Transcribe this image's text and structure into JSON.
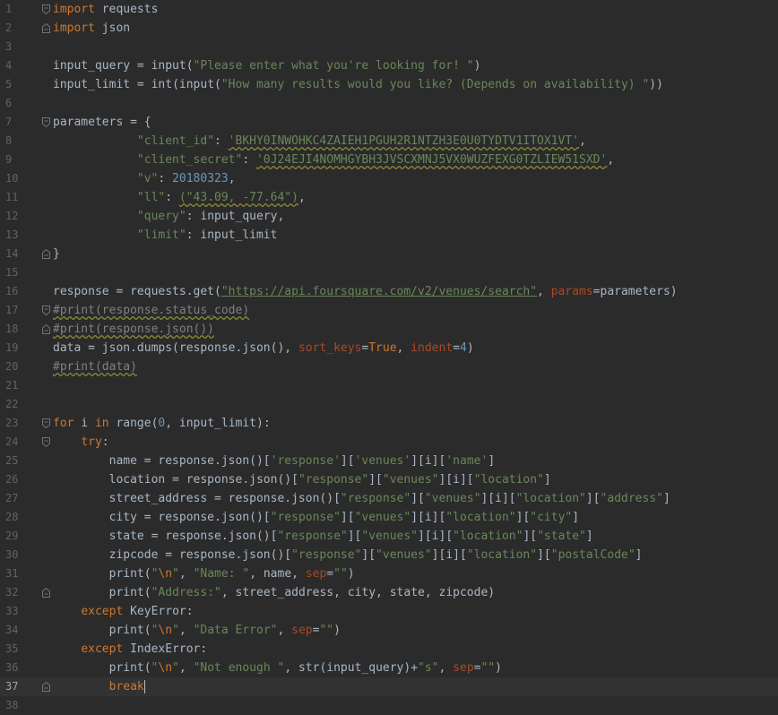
{
  "editor": {
    "current_line": 37,
    "lines": [
      {
        "n": "1",
        "fold": "start",
        "tokens": [
          [
            "kw",
            "import"
          ],
          [
            "p",
            " requests"
          ]
        ]
      },
      {
        "n": "2",
        "fold": "end",
        "tokens": [
          [
            "kw",
            "import"
          ],
          [
            "p",
            " json"
          ]
        ]
      },
      {
        "n": "3",
        "tokens": []
      },
      {
        "n": "4",
        "tokens": [
          [
            "p",
            "input_query = "
          ],
          [
            "fn",
            "input"
          ],
          [
            "p",
            "("
          ],
          [
            "str",
            "\"Please enter what you're looking for! \""
          ],
          [
            "p",
            ")"
          ]
        ]
      },
      {
        "n": "5",
        "tokens": [
          [
            "p",
            "input_limit = "
          ],
          [
            "fn",
            "int"
          ],
          [
            "p",
            "("
          ],
          [
            "fn",
            "input"
          ],
          [
            "p",
            "("
          ],
          [
            "str",
            "\"How many results would you like? (Depends on availability) \""
          ],
          [
            "p",
            "))"
          ]
        ]
      },
      {
        "n": "6",
        "tokens": []
      },
      {
        "n": "7",
        "fold": "start",
        "tokens": [
          [
            "p",
            "parameters = {"
          ]
        ]
      },
      {
        "n": "8",
        "tokens": [
          [
            "p",
            "            "
          ],
          [
            "str",
            "\"client_id\""
          ],
          [
            "p",
            ": "
          ],
          [
            "strw",
            "'BKHY0INWOHKC4ZAIEH1PGUH2R1NTZH3E0U0TYDTV1ITOX1VT'"
          ],
          [
            "p",
            ","
          ]
        ]
      },
      {
        "n": "9",
        "tokens": [
          [
            "p",
            "            "
          ],
          [
            "str",
            "\"client_secret\""
          ],
          [
            "p",
            ": "
          ],
          [
            "strw",
            "'0J24EJI4NOMHGYBH3JVSCXMNJ5VX0WUZFEXG0TZLIEW51SXD'"
          ],
          [
            "p",
            ","
          ]
        ]
      },
      {
        "n": "10",
        "tokens": [
          [
            "p",
            "            "
          ],
          [
            "str",
            "\"v\""
          ],
          [
            "p",
            ": "
          ],
          [
            "num",
            "20180323"
          ],
          [
            "p",
            ","
          ]
        ]
      },
      {
        "n": "11",
        "tokens": [
          [
            "p",
            "            "
          ],
          [
            "str",
            "\"ll\""
          ],
          [
            "p",
            ": "
          ],
          [
            "strw",
            "(\"43.09, -77.64\")"
          ],
          [
            "p",
            ","
          ]
        ]
      },
      {
        "n": "12",
        "tokens": [
          [
            "p",
            "            "
          ],
          [
            "str",
            "\"query\""
          ],
          [
            "p",
            ": input_query,"
          ]
        ]
      },
      {
        "n": "13",
        "tokens": [
          [
            "p",
            "            "
          ],
          [
            "str",
            "\"limit\""
          ],
          [
            "p",
            ": input_limit"
          ]
        ]
      },
      {
        "n": "14",
        "fold": "end",
        "tokens": [
          [
            "p",
            "}"
          ]
        ]
      },
      {
        "n": "15",
        "tokens": []
      },
      {
        "n": "16",
        "tokens": [
          [
            "p",
            "response = requests.get("
          ],
          [
            "url",
            "\"https://api.foursquare.com/v2/venues/search\""
          ],
          [
            "p",
            ", "
          ],
          [
            "kwarg",
            "params"
          ],
          [
            "p",
            "=parameters)"
          ]
        ]
      },
      {
        "n": "17",
        "fold": "start",
        "tokens": [
          [
            "cmt",
            "#print(response.status_code)"
          ]
        ]
      },
      {
        "n": "18",
        "fold": "end",
        "tokens": [
          [
            "cmt",
            "#print(response.json())"
          ]
        ]
      },
      {
        "n": "19",
        "tokens": [
          [
            "p",
            "data = json.dumps(response.json(), "
          ],
          [
            "kwarg",
            "sort_keys"
          ],
          [
            "p",
            "="
          ],
          [
            "kw",
            "True"
          ],
          [
            "p",
            ", "
          ],
          [
            "kwarg",
            "indent"
          ],
          [
            "p",
            "="
          ],
          [
            "num",
            "4"
          ],
          [
            "p",
            ")"
          ]
        ]
      },
      {
        "n": "20",
        "tokens": [
          [
            "cmt",
            "#print(data)"
          ]
        ]
      },
      {
        "n": "21",
        "tokens": []
      },
      {
        "n": "22",
        "tokens": []
      },
      {
        "n": "23",
        "fold": "start",
        "tokens": [
          [
            "kw",
            "for"
          ],
          [
            "p",
            " i "
          ],
          [
            "kw",
            "in"
          ],
          [
            "p",
            " "
          ],
          [
            "fn",
            "range"
          ],
          [
            "p",
            "("
          ],
          [
            "num",
            "0"
          ],
          [
            "p",
            ", input_limit):"
          ]
        ]
      },
      {
        "n": "24",
        "fold": "start",
        "tokens": [
          [
            "p",
            "    "
          ],
          [
            "kw",
            "try"
          ],
          [
            "p",
            ":"
          ]
        ]
      },
      {
        "n": "25",
        "tokens": [
          [
            "p",
            "        name = response.json()["
          ],
          [
            "str",
            "'response'"
          ],
          [
            "p",
            "]["
          ],
          [
            "str",
            "'venues'"
          ],
          [
            "p",
            "][i]["
          ],
          [
            "str",
            "'name'"
          ],
          [
            "p",
            "]"
          ]
        ]
      },
      {
        "n": "26",
        "tokens": [
          [
            "p",
            "        location = response.json()["
          ],
          [
            "str",
            "\"response\""
          ],
          [
            "p",
            "]["
          ],
          [
            "str",
            "\"venues\""
          ],
          [
            "p",
            "][i]["
          ],
          [
            "str",
            "\"location\""
          ],
          [
            "p",
            "]"
          ]
        ]
      },
      {
        "n": "27",
        "tokens": [
          [
            "p",
            "        street_address = response.json()["
          ],
          [
            "str",
            "\"response\""
          ],
          [
            "p",
            "]["
          ],
          [
            "str",
            "\"venues\""
          ],
          [
            "p",
            "][i]["
          ],
          [
            "str",
            "\"location\""
          ],
          [
            "p",
            "]["
          ],
          [
            "str",
            "\"address\""
          ],
          [
            "p",
            "]"
          ]
        ]
      },
      {
        "n": "28",
        "tokens": [
          [
            "p",
            "        city = response.json()["
          ],
          [
            "str",
            "\"response\""
          ],
          [
            "p",
            "]["
          ],
          [
            "str",
            "\"venues\""
          ],
          [
            "p",
            "][i]["
          ],
          [
            "str",
            "\"location\""
          ],
          [
            "p",
            "]["
          ],
          [
            "str",
            "\"city\""
          ],
          [
            "p",
            "]"
          ]
        ]
      },
      {
        "n": "29",
        "tokens": [
          [
            "p",
            "        state = response.json()["
          ],
          [
            "str",
            "\"response\""
          ],
          [
            "p",
            "]["
          ],
          [
            "str",
            "\"venues\""
          ],
          [
            "p",
            "][i]["
          ],
          [
            "str",
            "\"location\""
          ],
          [
            "p",
            "]["
          ],
          [
            "str",
            "\"state\""
          ],
          [
            "p",
            "]"
          ]
        ]
      },
      {
        "n": "30",
        "tokens": [
          [
            "p",
            "        zipcode = response.json()["
          ],
          [
            "str",
            "\"response\""
          ],
          [
            "p",
            "]["
          ],
          [
            "str",
            "\"venues\""
          ],
          [
            "p",
            "][i]["
          ],
          [
            "str",
            "\"location\""
          ],
          [
            "p",
            "]["
          ],
          [
            "str",
            "\"postalCode\""
          ],
          [
            "p",
            "]"
          ]
        ]
      },
      {
        "n": "31",
        "tokens": [
          [
            "p",
            "        "
          ],
          [
            "fn",
            "print"
          ],
          [
            "p",
            "("
          ],
          [
            "str",
            "\""
          ],
          [
            "esc",
            "\\n"
          ],
          [
            "str",
            "\""
          ],
          [
            "p",
            ", "
          ],
          [
            "str",
            "\"Name: \""
          ],
          [
            "p",
            ", name, "
          ],
          [
            "kwarg",
            "sep"
          ],
          [
            "p",
            "="
          ],
          [
            "str",
            "\"\""
          ],
          [
            "p",
            ")"
          ]
        ]
      },
      {
        "n": "32",
        "fold": "end",
        "tokens": [
          [
            "p",
            "        "
          ],
          [
            "fn",
            "print"
          ],
          [
            "p",
            "("
          ],
          [
            "str",
            "\"Address:\""
          ],
          [
            "p",
            ", street_address, city, state, zipcode)"
          ]
        ]
      },
      {
        "n": "33",
        "tokens": [
          [
            "p",
            "    "
          ],
          [
            "kw",
            "except"
          ],
          [
            "p",
            " "
          ],
          [
            "exc",
            "KeyError"
          ],
          [
            "p",
            ":"
          ]
        ]
      },
      {
        "n": "34",
        "tokens": [
          [
            "p",
            "        "
          ],
          [
            "fn",
            "print"
          ],
          [
            "p",
            "("
          ],
          [
            "str",
            "\""
          ],
          [
            "esc",
            "\\n"
          ],
          [
            "str",
            "\""
          ],
          [
            "p",
            ", "
          ],
          [
            "str",
            "\"Data Error\""
          ],
          [
            "p",
            ", "
          ],
          [
            "kwarg",
            "sep"
          ],
          [
            "p",
            "="
          ],
          [
            "str",
            "\"\""
          ],
          [
            "p",
            ")"
          ]
        ]
      },
      {
        "n": "35",
        "tokens": [
          [
            "p",
            "    "
          ],
          [
            "kw",
            "except"
          ],
          [
            "p",
            " "
          ],
          [
            "exc",
            "IndexError"
          ],
          [
            "p",
            ":"
          ]
        ]
      },
      {
        "n": "36",
        "tokens": [
          [
            "p",
            "        "
          ],
          [
            "fn",
            "print"
          ],
          [
            "p",
            "("
          ],
          [
            "str",
            "\""
          ],
          [
            "esc",
            "\\n"
          ],
          [
            "str",
            "\""
          ],
          [
            "p",
            ", "
          ],
          [
            "str",
            "\"Not enough \""
          ],
          [
            "p",
            ", "
          ],
          [
            "fn",
            "str"
          ],
          [
            "p",
            "(input_query)+"
          ],
          [
            "str",
            "\"s\""
          ],
          [
            "p",
            ", "
          ],
          [
            "kwarg",
            "sep"
          ],
          [
            "p",
            "="
          ],
          [
            "str",
            "\"\""
          ],
          [
            "p",
            ")"
          ]
        ]
      },
      {
        "n": "37",
        "fold": "end",
        "tokens": [
          [
            "p",
            "        "
          ],
          [
            "kw",
            "break"
          ],
          [
            "cursor",
            ""
          ]
        ]
      },
      {
        "n": "38",
        "tokens": []
      }
    ]
  }
}
